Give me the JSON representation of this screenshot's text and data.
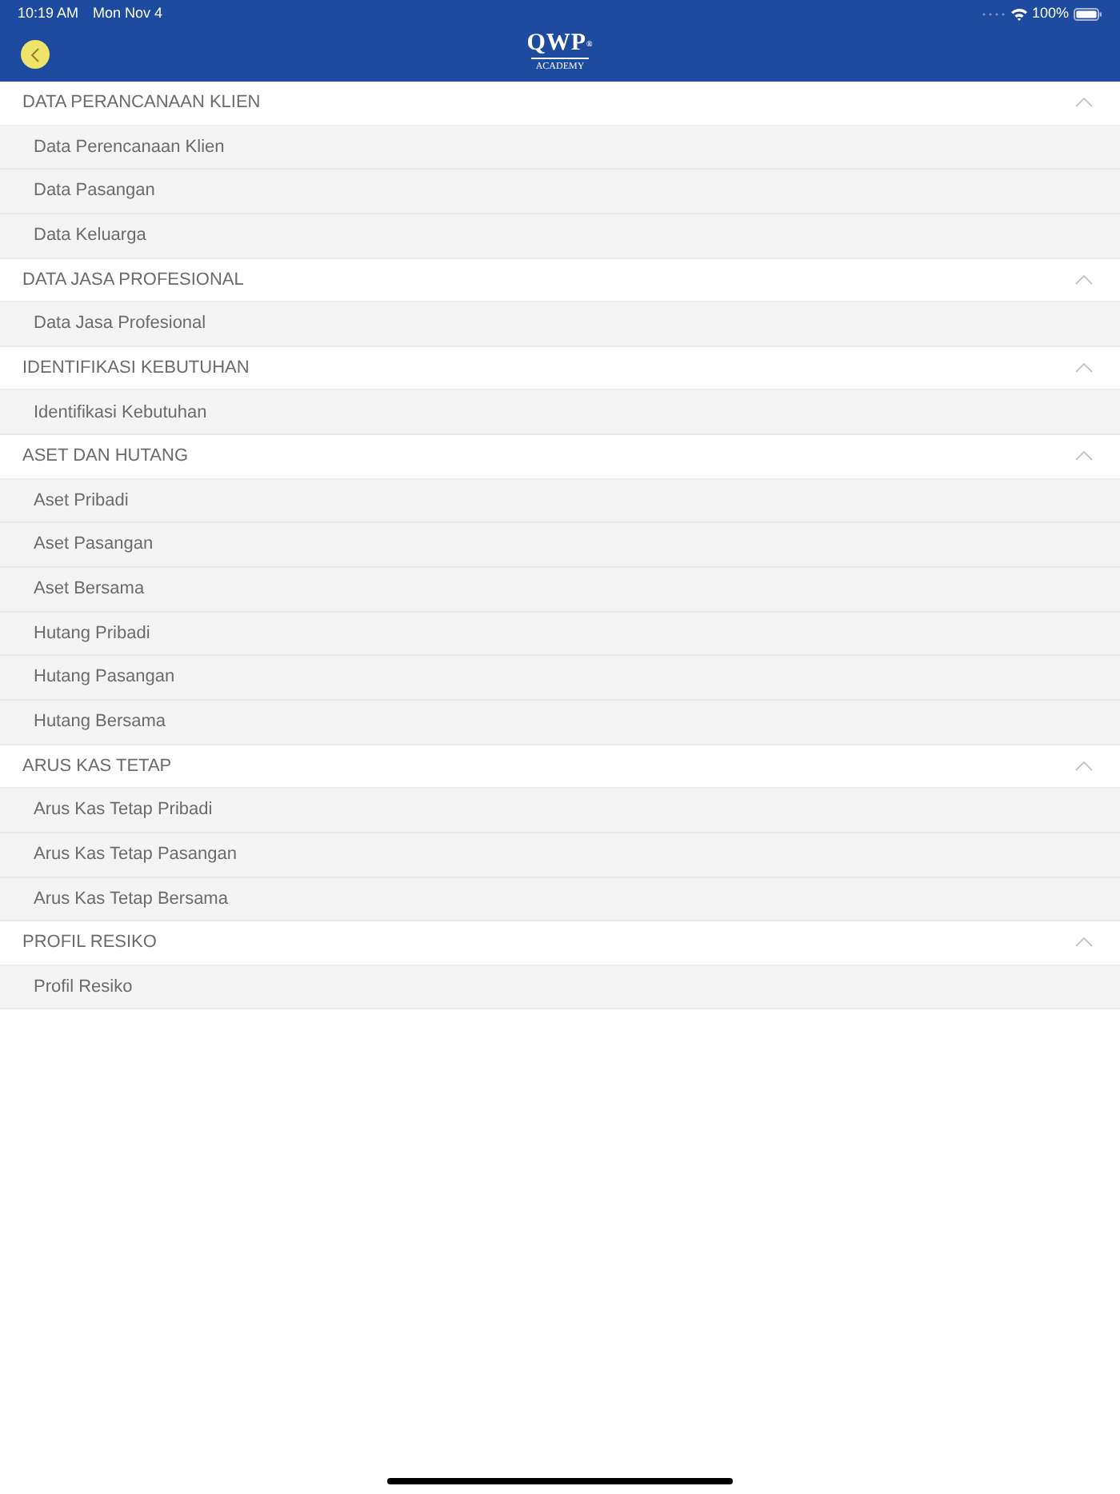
{
  "status_bar": {
    "time": "10:19 AM",
    "date": "Mon Nov 4",
    "battery": "100%"
  },
  "nav_bar": {
    "logo": {
      "title": "QWP$^{®}$",
      "subtitle": "ACADEMY"
    }
  },
  "sections": [
    {
      "title": "DATA PERANCANAAN KLIEN",
      "expanded": true,
      "items": [
        "Data Perencanaan Klien",
        "Data Pasangan",
        "Data Keluarga"
      ]
    },
    {
      "title": "DATA JASA PROFESIONAL",
      "expanded": true,
      "items": [
        "Data Jasa Profesional"
      ]
    },
    {
      "title": "IDENTIFIKASI KEBUTUHAN",
      "expanded": true,
      "items": [
        "Identifikasi Kebutuhan"
      ]
    },
    {
      "title": "ASET DAN HUTANG",
      "expanded": true,
      "items": [
        "Aset Pribadi",
        "Aset Pasangan",
        "Aset Bersama",
        "Hutang Pribadi",
        "Hutang Pasangan",
        "Hutang Bersama"
      ]
    },
    {
      "title": "ARUS KAS TETAP",
      "expanded": true,
      "items": [
        "Arus Kas Tetap Pribadi",
        "Arus Kas Tetap Pasangan",
        "Arus Kas Tetap Bersama"
      ]
    },
    {
      "title": "PROFIL RESIKO",
      "expanded": true,
      "items": [
        "Profil Resiko"
      ]
    }
  ]
}
